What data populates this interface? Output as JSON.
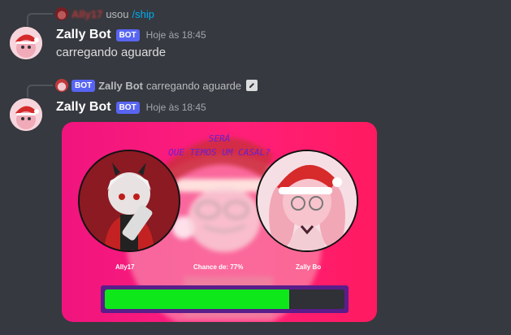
{
  "messages": [
    {
      "reply": {
        "name": "Ally17",
        "text": "usou",
        "command": "/ship"
      },
      "author": "Zally Bot",
      "badge": "BOT",
      "timestamp": "Hoje às 18:45",
      "content": "carregando aguarde"
    },
    {
      "reply": {
        "author": "Zally Bot",
        "badge": "BOT",
        "text": "carregando aguarde"
      },
      "author": "Zally Bot",
      "badge": "BOT",
      "timestamp": "Hoje às 18:45"
    }
  ],
  "ship_card": {
    "title_line1": "SERÁ",
    "title_line2": "QUE TEMOS UM CASAL?",
    "left_name": "Ally17",
    "right_name": "Zally Bo",
    "chance_text": "Chance de: 77%",
    "chance_percent": 77,
    "colors": {
      "card": "#ff1f7a",
      "bar_fill": "#0ee81a",
      "bar_frame": "#5a1d8a",
      "title": "#6a1fd1"
    }
  },
  "icons": {
    "edit": "edit-icon",
    "mini_avatar": "user-avatar-icon"
  }
}
